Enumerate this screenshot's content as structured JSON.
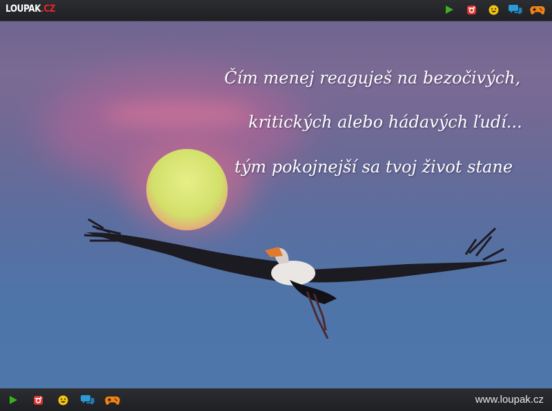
{
  "header": {
    "logo_main": "LOUPAK",
    "logo_suffix": ".CZ",
    "icons": [
      "play-icon",
      "instagram-icon",
      "smiley-icon",
      "chat-icon",
      "gamepad-icon"
    ]
  },
  "quote": {
    "lines": [
      "Čím menej reaguješ na bezočivých,",
      "kritických alebo hádavých ľudí...",
      "tým pokojnejší sa tvoj život stane"
    ]
  },
  "footer": {
    "icons": [
      "play-icon",
      "instagram-icon",
      "smiley-icon",
      "chat-icon",
      "gamepad-icon"
    ],
    "url": "www.loupak.cz"
  },
  "colors": {
    "bar_background": "#232428",
    "logo_red": "#e3262b",
    "play_green": "#3cb020",
    "instagram_red": "#e0312f",
    "smiley_yellow": "#f2c511",
    "chat_blue": "#2a9ad8",
    "gamepad_orange": "#f08418",
    "sky_top": "#6f6590",
    "sky_bottom": "#4d77ab",
    "sun": "#d8e87a"
  }
}
